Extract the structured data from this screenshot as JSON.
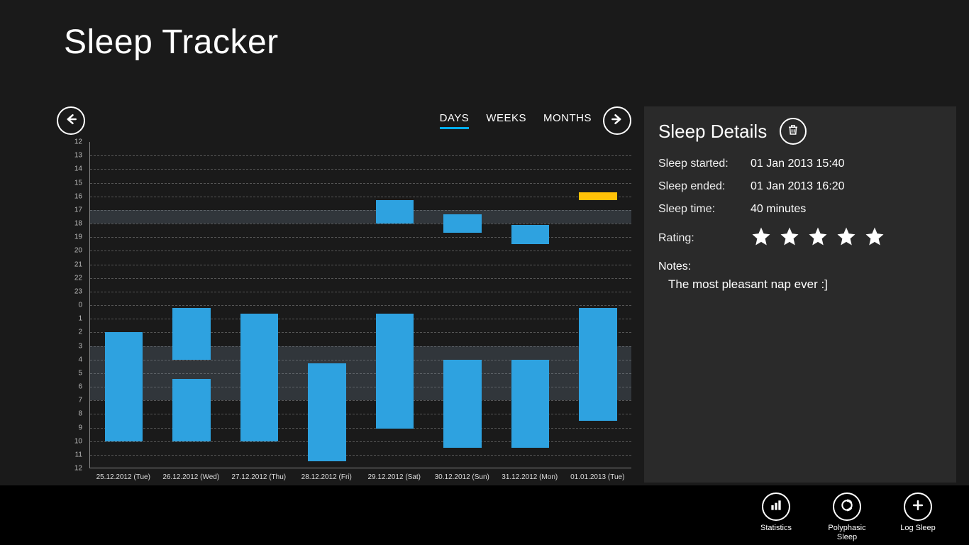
{
  "app": {
    "title": "Sleep Tracker"
  },
  "nav": {
    "tabs": [
      {
        "label": "DAYS",
        "active": true
      },
      {
        "label": "WEEKS",
        "active": false
      },
      {
        "label": "MONTHS",
        "active": false
      }
    ]
  },
  "chart_data": {
    "type": "range-bar",
    "y_ticks": [
      12,
      13,
      14,
      15,
      16,
      17,
      18,
      19,
      20,
      21,
      22,
      23,
      0,
      1,
      2,
      3,
      4,
      5,
      6,
      7,
      8,
      9,
      10,
      11,
      12
    ],
    "bands": [
      {
        "from_idx": 5,
        "to_idx": 6
      },
      {
        "from_idx": 15,
        "to_idx": 19
      }
    ],
    "categories": [
      "25.12.2012 (Tue)",
      "26.12.2012 (Wed)",
      "27.12.2012 (Thu)",
      "28.12.2012 (Fri)",
      "29.12.2012 (Sat)",
      "30.12.2012 (Sun)",
      "31.12.2012 (Mon)",
      "01.01.2013 (Tue)"
    ],
    "series": [
      {
        "day": 0,
        "bars": [
          {
            "from_idx": 14.0,
            "to_idx": 22.0
          }
        ]
      },
      {
        "day": 1,
        "bars": [
          {
            "from_idx": 12.2,
            "to_idx": 16.0
          },
          {
            "from_idx": 17.4,
            "to_idx": 22.0
          }
        ]
      },
      {
        "day": 2,
        "bars": [
          {
            "from_idx": 12.6,
            "to_idx": 22.0
          }
        ]
      },
      {
        "day": 3,
        "bars": [
          {
            "from_idx": 16.3,
            "to_idx": 23.5
          }
        ]
      },
      {
        "day": 4,
        "bars": [
          {
            "from_idx": 4.3,
            "to_idx": 6.0
          },
          {
            "from_idx": 12.6,
            "to_idx": 21.1
          }
        ]
      },
      {
        "day": 5,
        "bars": [
          {
            "from_idx": 5.3,
            "to_idx": 6.7
          },
          {
            "from_idx": 16.0,
            "to_idx": 22.5
          }
        ]
      },
      {
        "day": 6,
        "bars": [
          {
            "from_idx": 6.1,
            "to_idx": 7.5
          },
          {
            "from_idx": 16.0,
            "to_idx": 22.5
          }
        ]
      },
      {
        "day": 7,
        "bars": [
          {
            "from_idx": 3.7,
            "to_idx": 4.3,
            "selected": true
          },
          {
            "from_idx": 12.2,
            "to_idx": 20.5
          }
        ]
      }
    ]
  },
  "details": {
    "title": "Sleep Details",
    "rows": {
      "started_label": "Sleep started:",
      "started_value": "01 Jan 2013 15:40",
      "ended_label": "Sleep ended:",
      "ended_value": "01 Jan 2013 16:20",
      "time_label": "Sleep time:",
      "time_value": "40 minutes",
      "rating_label": "Rating:",
      "rating_value": 5,
      "notes_label": "Notes:",
      "notes_value": "The most pleasant nap ever :]"
    }
  },
  "appbar": {
    "statistics": "Statistics",
    "polyphasic": "Polyphasic\nSleep",
    "log": "Log Sleep"
  }
}
